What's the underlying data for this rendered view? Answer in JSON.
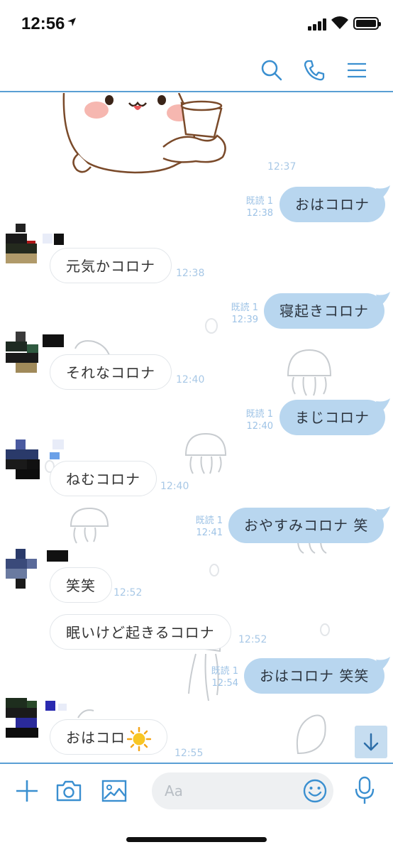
{
  "status_bar": {
    "time": "12:56"
  },
  "header": {
    "contact_name": ""
  },
  "messages": [
    {
      "id": "sticker",
      "direction": "in",
      "type": "sticker",
      "time": "12:37"
    },
    {
      "id": "m1",
      "direction": "out",
      "text": "おはコロナ",
      "read": "既読 1",
      "time": "12:38"
    },
    {
      "id": "m2",
      "direction": "in",
      "text": "元気かコロナ",
      "time": "12:38"
    },
    {
      "id": "m3",
      "direction": "out",
      "text": "寝起きコロナ",
      "read": "既読 1",
      "time": "12:39"
    },
    {
      "id": "m4",
      "direction": "in",
      "text": "それなコロナ",
      "time": "12:40"
    },
    {
      "id": "m5",
      "direction": "out",
      "text": "まじコロナ",
      "read": "既読 1",
      "time": "12:40"
    },
    {
      "id": "m6",
      "direction": "in",
      "text": "ねむコロナ",
      "time": "12:40"
    },
    {
      "id": "m7",
      "direction": "out",
      "text": "おやすみコロナ 笑",
      "read": "既読 1",
      "time": "12:41"
    },
    {
      "id": "m8",
      "direction": "in",
      "text": "笑笑",
      "time": "12:52"
    },
    {
      "id": "m9",
      "direction": "in",
      "text": "眠いけど起きるコロナ",
      "time": "12:52"
    },
    {
      "id": "m10",
      "direction": "out",
      "text": "おはコロナ 笑笑",
      "read": "既読 1",
      "time": "12:54"
    },
    {
      "id": "m11",
      "direction": "in",
      "text": "おはコロ",
      "emoji": "sun-emoji",
      "time": "12:55"
    }
  ],
  "input": {
    "placeholder": "Aa"
  },
  "icons": {
    "search": "search-icon",
    "call": "phone-icon",
    "menu": "menu-icon",
    "add": "plus-icon",
    "camera": "camera-icon",
    "image": "image-icon",
    "emoji": "smiley-icon",
    "mic": "microphone-icon",
    "scroll": "arrow-down-icon"
  },
  "colors": {
    "accent": "#3a8fd0",
    "outgoing_bubble": "#b8d6ef",
    "divider": "#5a9fd4"
  }
}
